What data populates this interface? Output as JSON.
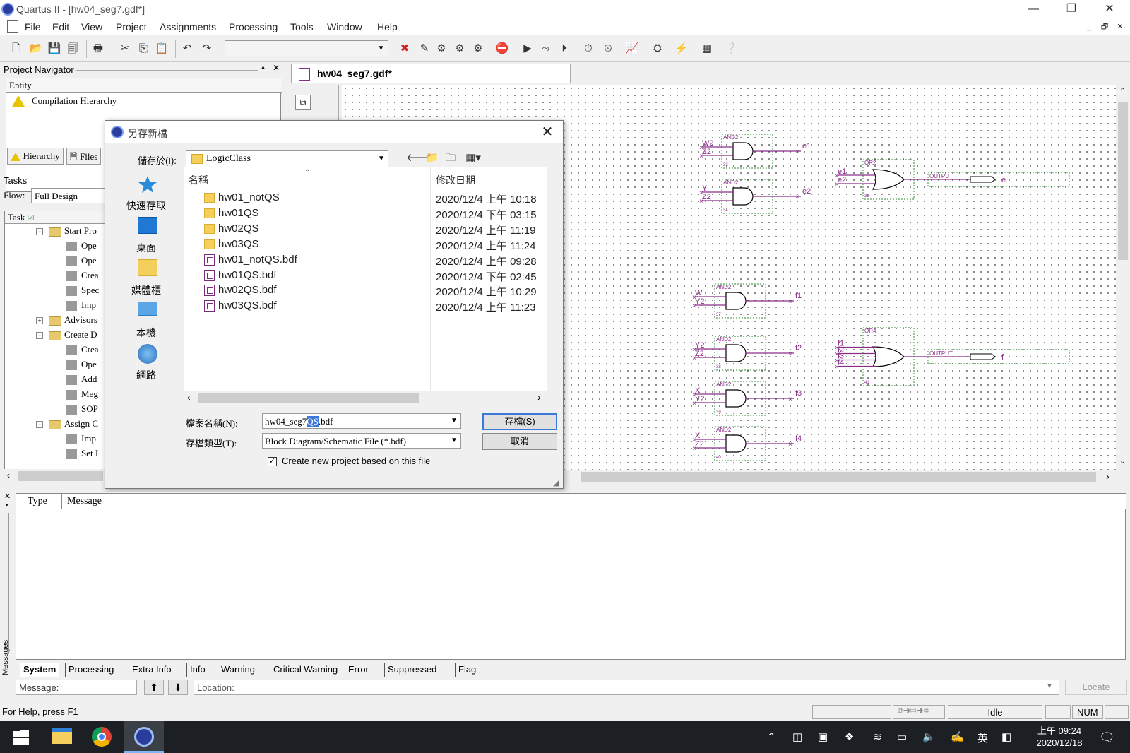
{
  "window": {
    "title": "Quartus II - [hw04_seg7.gdf*]",
    "controls": [
      "—",
      "❐",
      "✕"
    ]
  },
  "menu": {
    "items": [
      "File",
      "Edit",
      "View",
      "Project",
      "Assignments",
      "Processing",
      "Tools",
      "Window",
      "Help"
    ],
    "mdi_controls": [
      "_",
      "🗗",
      "✕"
    ]
  },
  "toolbar": {
    "combo_value": ""
  },
  "navigator": {
    "title": "Project Navigator",
    "pin": "▴",
    "close": "✕",
    "column_header": "Entity",
    "root_item": "Compilation Hierarchy",
    "tabs": [
      "Hierarchy",
      "Files"
    ]
  },
  "tasks": {
    "title": "Tasks",
    "flow_label": "Flow:",
    "flow_value": "Full Design",
    "column_header": "Task",
    "rows": [
      {
        "kind": "folder",
        "indent": 1,
        "label": "Start Pro",
        "toggle": "−"
      },
      {
        "kind": "item",
        "indent": 2,
        "label": "Ope"
      },
      {
        "kind": "item",
        "indent": 2,
        "label": "Ope"
      },
      {
        "kind": "item",
        "indent": 2,
        "label": "Crea"
      },
      {
        "kind": "item",
        "indent": 2,
        "label": "Spec"
      },
      {
        "kind": "item",
        "indent": 2,
        "label": "Imp"
      },
      {
        "kind": "folder",
        "indent": 1,
        "label": "Advisors",
        "toggle": "+"
      },
      {
        "kind": "folder",
        "indent": 1,
        "label": "Create D",
        "toggle": "−"
      },
      {
        "kind": "item",
        "indent": 2,
        "label": "Crea"
      },
      {
        "kind": "item",
        "indent": 2,
        "label": "Ope"
      },
      {
        "kind": "item",
        "indent": 2,
        "label": "Add"
      },
      {
        "kind": "item",
        "indent": 2,
        "label": "Meg"
      },
      {
        "kind": "item",
        "indent": 2,
        "label": "SOP"
      },
      {
        "kind": "folder",
        "indent": 1,
        "label": "Assign C",
        "toggle": "−"
      },
      {
        "kind": "item",
        "indent": 2,
        "label": "Imp"
      },
      {
        "kind": "item",
        "indent": 2,
        "label": "Set I"
      }
    ]
  },
  "document": {
    "tab_label": "hw04_seg7.gdf*"
  },
  "schematic": {
    "gates": [
      {
        "type": "AND2",
        "in": [
          "W2",
          "Z2"
        ],
        "out": "e1",
        "num": "33"
      },
      {
        "type": "AND2",
        "in": [
          "Y",
          "Z2"
        ],
        "out": "e2",
        "num": "34"
      },
      {
        "type": "OR2",
        "in": [
          "e1",
          "e2"
        ],
        "out": "OUTPUT",
        "pin": "e",
        "num": "35"
      },
      {
        "type": "AND2",
        "in": [
          "W",
          "Y2"
        ],
        "out": "f1",
        "num": "37"
      },
      {
        "type": "AND2",
        "in": [
          "Y2",
          "Z2"
        ],
        "out": "f2",
        "num": "38"
      },
      {
        "type": "AND2",
        "in": [
          "X",
          "Y2"
        ],
        "out": "f3",
        "num": "39"
      },
      {
        "type": "AND2",
        "in": [
          "X",
          "Z2"
        ],
        "out": "f4",
        "num": "40"
      },
      {
        "type": "OR4",
        "in": [
          "f1",
          "f2",
          "f3",
          "f4"
        ],
        "out": "OUTPUT",
        "pin": "f",
        "num": "41"
      }
    ]
  },
  "save_dialog": {
    "title": "另存新檔",
    "save_in_label": "儲存於(I):",
    "save_in_value": "LogicClass",
    "places": [
      "快速存取",
      "桌面",
      "媒體櫃",
      "本機",
      "網路"
    ],
    "columns": {
      "name": "名稱",
      "modified": "修改日期"
    },
    "files": [
      {
        "type": "folder",
        "name": "hw01_notQS",
        "date": "2020/12/4 上午 10:18"
      },
      {
        "type": "folder",
        "name": "hw01QS",
        "date": "2020/12/4 下午 03:15"
      },
      {
        "type": "folder",
        "name": "hw02QS",
        "date": "2020/12/4 上午 11:19"
      },
      {
        "type": "folder",
        "name": "hw03QS",
        "date": "2020/12/4 上午 11:24"
      },
      {
        "type": "bdf",
        "name": "hw01_notQS.bdf",
        "date": "2020/12/4 上午 09:28"
      },
      {
        "type": "bdf",
        "name": "hw01QS.bdf",
        "date": "2020/12/4 下午 02:45"
      },
      {
        "type": "bdf",
        "name": "hw02QS.bdf",
        "date": "2020/12/4 上午 10:29"
      },
      {
        "type": "bdf",
        "name": "hw03QS.bdf",
        "date": "2020/12/4 上午 11:23"
      }
    ],
    "filename_label": "檔案名稱(N):",
    "filename_pre": "hw04_seg7",
    "filename_sel": "QS",
    "filename_post": ".bdf",
    "filetype_label": "存檔類型(T):",
    "filetype_value": "Block Diagram/Schematic File (*.bdf)",
    "save_button": "存檔(S)",
    "cancel_button": "取消",
    "checkbox_label": "Create new project based on this file",
    "checkbox_checked": true
  },
  "messages": {
    "side_label": "Messages",
    "columns": [
      "Type",
      "Message"
    ],
    "tabs": [
      "System",
      "Processing",
      "Extra Info",
      "Info",
      "Warning",
      "Critical Warning",
      "Error",
      "Suppressed",
      "Flag"
    ],
    "message_label": "Message:",
    "location_placeholder": "Location:",
    "locate_button": "Locate"
  },
  "statusbar": {
    "help": "For Help, press F1",
    "state": "Idle",
    "num": "NUM"
  },
  "taskbar": {
    "time": "上午 09:24",
    "date": "2020/12/18",
    "ime": "英"
  }
}
